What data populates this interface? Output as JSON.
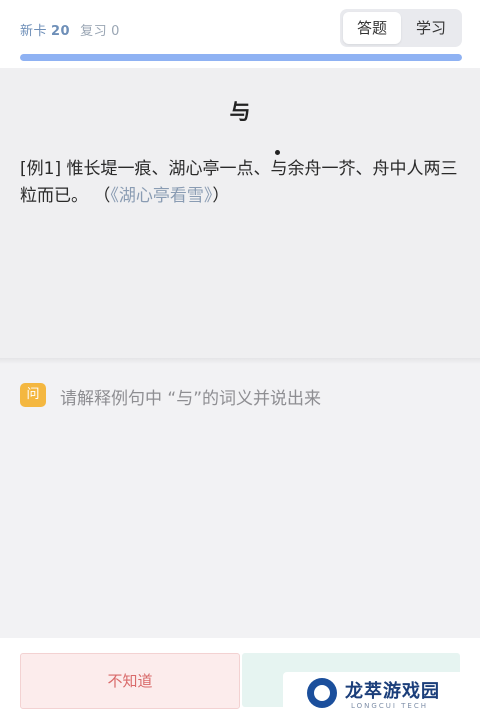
{
  "header": {
    "new_label": "新卡",
    "new_count": "20",
    "review_label": "复习",
    "review_count": "0",
    "tabs": [
      {
        "label": "答题",
        "active": true
      },
      {
        "label": "学习",
        "active": false
      }
    ]
  },
  "progress": {
    "fraction": 1.0
  },
  "card": {
    "word": "与",
    "example_prefix": "[例1] 惟长堤一痕、湖心亭一点、",
    "example_target": "与",
    "example_suffix": "余舟一芥、舟中人两三粒而已。 （",
    "example_source": "《湖心亭看雪》",
    "example_close": "）"
  },
  "question": {
    "badge": "问",
    "text": "请解释例句中 “与”的词义并说出来"
  },
  "actions": {
    "unknown_label": "不知道",
    "know_label": ""
  },
  "watermark": {
    "title": "龙萃游戏园",
    "subtitle": "LONGCUI TECH"
  },
  "colors": {
    "accent": "#8fb2f3",
    "badge": "#f4b740",
    "unknown_text": "#d96a6a",
    "know_bg": "#e6f4f1"
  }
}
